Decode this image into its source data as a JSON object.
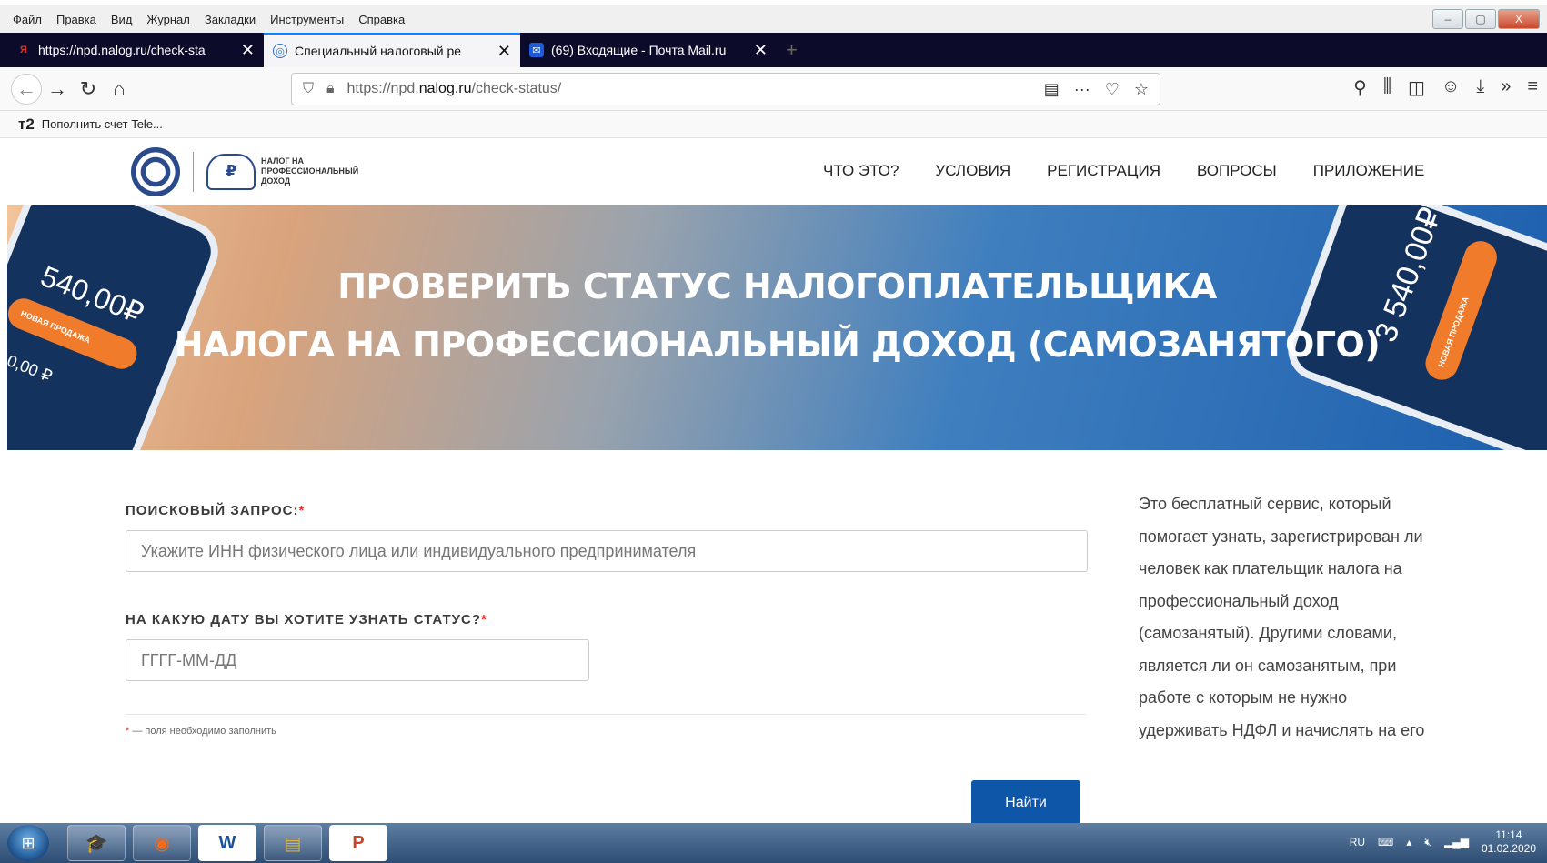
{
  "menubar": {
    "items": [
      "Файл",
      "Правка",
      "Вид",
      "Журнал",
      "Закладки",
      "Инструменты",
      "Справка"
    ],
    "window_controls": [
      "–",
      "▢",
      "X"
    ]
  },
  "tabs": [
    {
      "title": "https://npd.nalog.ru/check-sta",
      "favicon": "Я",
      "active": false
    },
    {
      "title": "Специальный налоговый ре",
      "favicon": "◎",
      "active": true
    },
    {
      "title": "(69) Входящие - Почта Mail.ru",
      "favicon": "✉",
      "active": false
    }
  ],
  "tab_new": "+",
  "navbar": {
    "url_prefix": "https://npd.",
    "url_domain": "nalog.ru",
    "url_path": "/check-status/"
  },
  "bookmarks": {
    "icon": "т2",
    "label": "Пополнить счет Tele..."
  },
  "site": {
    "logo_text": "НАЛОГ НА ПРОФЕССИОНАЛЬНЫЙ ДОХОД",
    "nav": [
      "ЧТО ЭТО?",
      "УСЛОВИЯ",
      "РЕГИСТРАЦИЯ",
      "ВОПРОСЫ",
      "ПРИЛОЖЕНИЕ"
    ]
  },
  "banner": {
    "title_line1": "ПРОВЕРИТЬ СТАТУС НАЛОГОПЛАТЕЛЬЩИКА",
    "title_line2": "НАЛОГА НА ПРОФЕССИОНАЛЬНЫЙ ДОХОД (САМОЗАНЯТОГО)",
    "phone_left_amount": "540,00₽",
    "phone_left_small": "0,00 ₽",
    "phone_left_pill": "НОВАЯ ПРОДАЖА",
    "phone_right_amount": "3 540,00₽",
    "phone_right_pill": "НОВАЯ ПРОДАЖА"
  },
  "form": {
    "search_label": "ПОИСКОВЫЙ ЗАПРОС:",
    "search_placeholder": "Укажите ИНН физического лица или индивидуального предпринимателя",
    "date_label": "НА КАКУЮ ДАТУ ВЫ ХОТИТЕ УЗНАТЬ СТАТУС?",
    "date_placeholder": "ГГГГ-ММ-ДД",
    "required_mark": "*",
    "required_note": "— поля необходимо заполнить",
    "submit": "Найти"
  },
  "aside": {
    "text": "Это бесплатный сервис, который помогает узнать, зарегистрирован ли человек как плательщик налога на профессиональный доход (самозанятый). Другими словами, является ли он самозанятым, при работе с которым не нужно удерживать НДФЛ и начислять на его"
  },
  "taskbar": {
    "apps": [
      "🎓",
      "◉",
      "W",
      "▤",
      "P"
    ],
    "tray_lang": "RU",
    "time": "11:14",
    "date": "01.02.2020"
  }
}
